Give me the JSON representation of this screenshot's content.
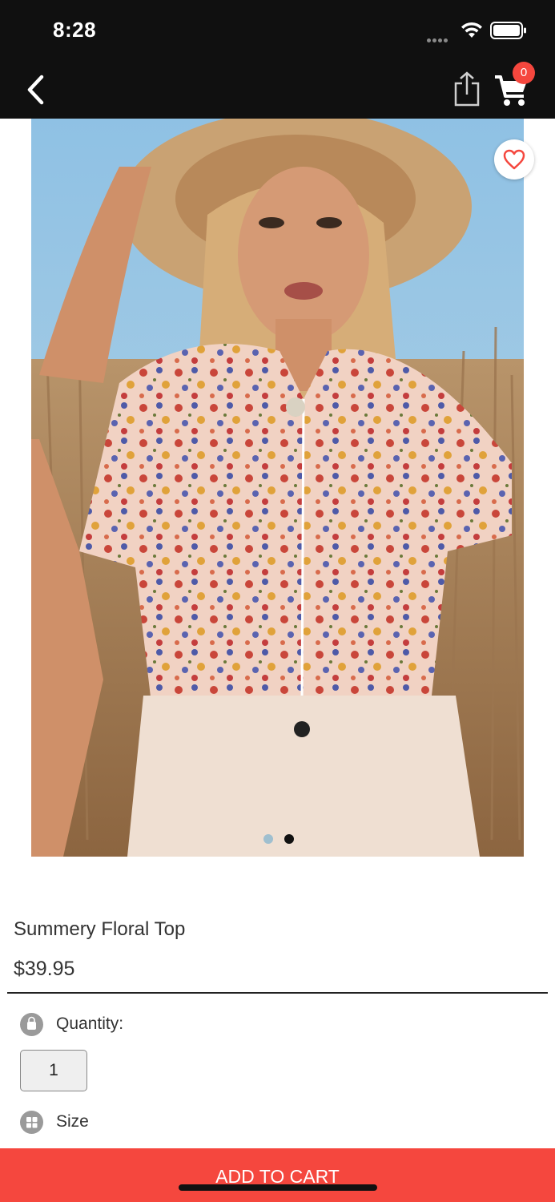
{
  "status_bar": {
    "time": "8:28"
  },
  "nav": {
    "cart_count": "0"
  },
  "product": {
    "title": "Summery Floral Top",
    "price": "$39.95",
    "image_count": 2,
    "active_image_index": 1
  },
  "options": {
    "quantity_label": "Quantity:",
    "quantity_value": "1",
    "size_label": "Size"
  },
  "actions": {
    "add_to_cart_label": "ADD TO CART"
  },
  "colors": {
    "accent": "#f5473e",
    "bar": "#101010"
  }
}
